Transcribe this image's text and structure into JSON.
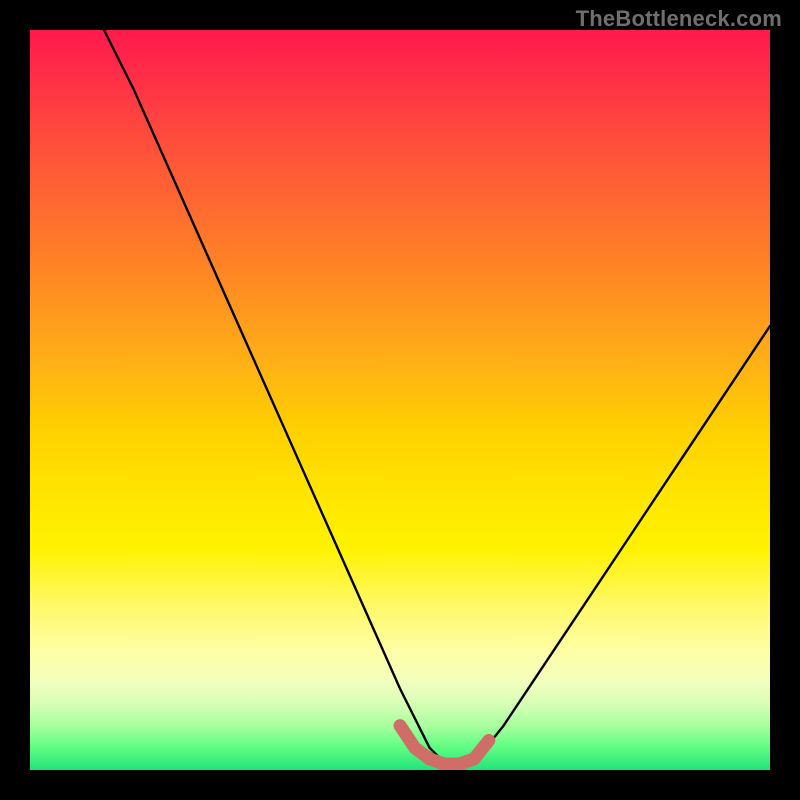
{
  "watermark": "TheBottleneck.com",
  "chart_data": {
    "type": "line",
    "title": "",
    "xlabel": "",
    "ylabel": "",
    "xlim": [
      0,
      100
    ],
    "ylim": [
      0,
      100
    ],
    "series": [
      {
        "name": "bottleneck-curve",
        "x": [
          10,
          14,
          18,
          22,
          26,
          30,
          34,
          38,
          42,
          46,
          50,
          54,
          56,
          58,
          60,
          64,
          68,
          72,
          76,
          80,
          84,
          88,
          92,
          96,
          100
        ],
        "values": [
          100,
          92,
          83,
          74,
          65,
          56,
          47,
          38,
          29,
          20,
          11,
          3,
          1,
          0,
          1,
          6,
          12,
          18,
          24,
          30,
          36,
          42,
          48,
          54,
          60
        ]
      }
    ],
    "highlight_segment": {
      "name": "optimal-range",
      "x": [
        50,
        52,
        54,
        56,
        58,
        60,
        62
      ],
      "values": [
        6,
        3,
        1.5,
        0.8,
        0.8,
        1.5,
        4
      ],
      "color": "#cf6e66"
    },
    "background_gradient_stops": [
      {
        "pos": 0.0,
        "color": "#ff1a4d"
      },
      {
        "pos": 0.14,
        "color": "#ff4a3d"
      },
      {
        "pos": 0.34,
        "color": "#ff8a22"
      },
      {
        "pos": 0.54,
        "color": "#ffd000"
      },
      {
        "pos": 0.78,
        "color": "#fff96a"
      },
      {
        "pos": 0.94,
        "color": "#a8ff9e"
      },
      {
        "pos": 1.0,
        "color": "#22e37a"
      }
    ]
  }
}
